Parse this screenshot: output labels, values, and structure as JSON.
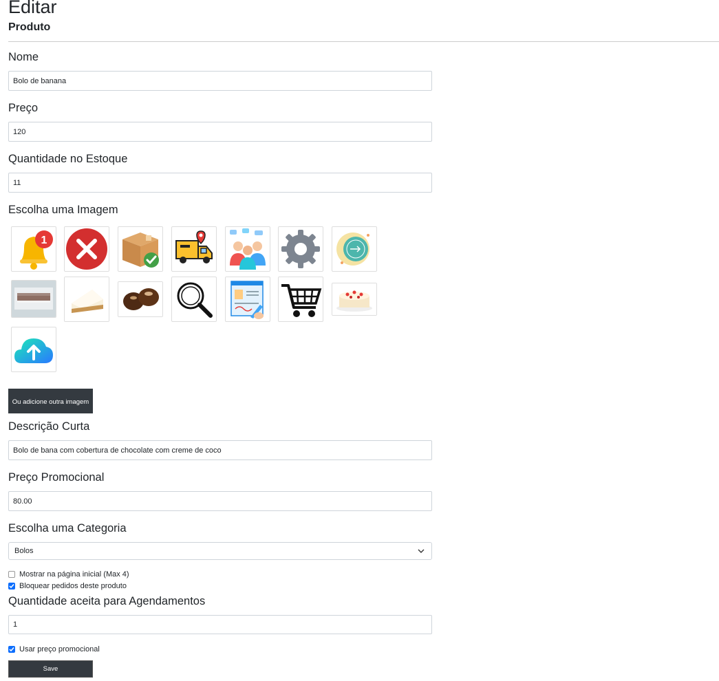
{
  "header": {
    "title": "Editar",
    "subtitle": "Produto"
  },
  "form": {
    "nome": {
      "label": "Nome",
      "value": "Bolo de banana"
    },
    "preco": {
      "label": "Preço",
      "value": "120"
    },
    "estoque": {
      "label": "Quantidade no Estoque",
      "value": "11"
    },
    "imagem": {
      "label": "Escolha uma Imagem",
      "images": [
        "notification-bell-icon",
        "error-x-icon",
        "delivered-box-icon",
        "delivery-truck-icon",
        "team-chat-icon",
        "settings-gear-icon",
        "time-clock-icon",
        "cake-tray-photo",
        "cheesecake-slice-photo",
        "chocolate-truffles-photo",
        "magnifier-icon",
        "document-signing-icon",
        "shopping-cart-icon",
        "strawberry-cake-photo",
        "cloud-upload-icon"
      ],
      "add_button": "Ou adicione outra imagem"
    },
    "descricao": {
      "label": "Descrição Curta",
      "value": "Bolo de bana com cobertura de chocolate com creme de coco"
    },
    "preco_promocional": {
      "label": "Preço Promocional",
      "value": "80.00"
    },
    "categoria": {
      "label": "Escolha uma Categoria",
      "selected": "Bolos"
    },
    "mostrar_inicial": {
      "label": "Mostrar na página inicial (Max 4)",
      "checked": false
    },
    "bloquear": {
      "label": "Bloquear pedidos deste produto",
      "checked": true
    },
    "agendamentos": {
      "label": "Quantidade aceita para Agendamentos",
      "value": "1"
    },
    "usar_promocional": {
      "label": "Usar preço promocional",
      "checked": true
    },
    "save": "Save"
  },
  "colors": {
    "button_dark": "#343a40",
    "checkbox_checked": "#0d6efd",
    "border": "#ced4da"
  }
}
